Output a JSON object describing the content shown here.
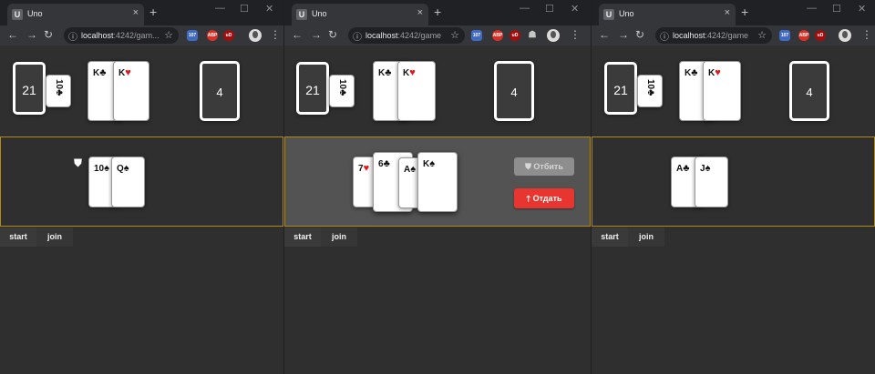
{
  "browser": {
    "tab_title": "Uno",
    "tab_close": "×",
    "new_tab": "+",
    "favicon_letter": "U",
    "url_host": "localhost",
    "url_rest_short": ":4242/gam...",
    "url_rest_full": ":4242/game",
    "window_controls": [
      "—",
      "☐",
      "✕"
    ],
    "nav": {
      "back": "←",
      "forward": "→",
      "reload": "↻"
    },
    "info_icon": "ⓘ",
    "star": "☆",
    "menu": "⋮",
    "extensions": {
      "badge_count": "107",
      "abp": "ABP",
      "ud": "uD",
      "shield": "☗"
    }
  },
  "windows": [
    {
      "deck_count": "21",
      "trump_card": {
        "rank": "10",
        "suit": "♣"
      },
      "opponent_cards": [
        {
          "rank": "K",
          "suit": "♣",
          "red": false
        },
        {
          "rank": "K",
          "suit": "♥",
          "red": true
        }
      ],
      "pile_count": "4",
      "table_cards": [
        {
          "rank": "10",
          "suit": "♠",
          "red": false
        },
        {
          "rank": "Q",
          "suit": "♠",
          "red": false
        }
      ],
      "shield_icon": "⛊",
      "actions": {
        "start": "start",
        "join": "join"
      }
    },
    {
      "deck_count": "21",
      "trump_card": {
        "rank": "10",
        "suit": "♣"
      },
      "opponent_cards": [
        {
          "rank": "K",
          "suit": "♣",
          "red": false
        },
        {
          "rank": "K",
          "suit": "♥",
          "red": true
        }
      ],
      "pile_count": "4",
      "hand_cards": [
        {
          "rank": "7",
          "suit": "♥",
          "red": true
        },
        {
          "rank": "6",
          "suit": "♣",
          "red": false
        },
        {
          "rank": "A",
          "suit": "♠",
          "red": false
        },
        {
          "rank": "K",
          "suit": "♠",
          "red": false
        }
      ],
      "defend_label": "Отбить",
      "give_label": "Отдать",
      "actions": {
        "start": "start",
        "join": "join"
      }
    },
    {
      "deck_count": "21",
      "trump_card": {
        "rank": "10",
        "suit": "♣"
      },
      "opponent_cards": [
        {
          "rank": "K",
          "suit": "♣",
          "red": false
        },
        {
          "rank": "K",
          "suit": "♥",
          "red": true
        }
      ],
      "pile_count": "4",
      "table_cards": [
        {
          "rank": "A",
          "suit": "♣",
          "red": false
        },
        {
          "rank": "J",
          "suit": "♠",
          "red": false
        }
      ],
      "actions": {
        "start": "start",
        "join": "join"
      }
    }
  ],
  "colors": {
    "give_button": "#e8352f",
    "table_border": "#b08a12",
    "active_table": "#535353"
  }
}
